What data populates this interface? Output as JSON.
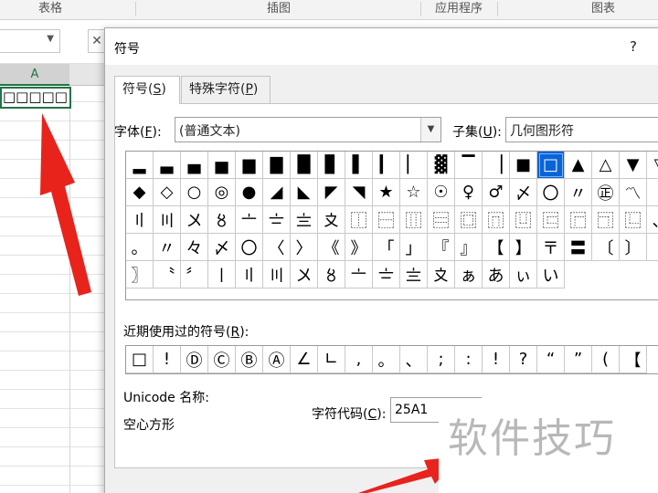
{
  "ribbon": {
    "groups": [
      "表格",
      "插图",
      "应用程序",
      "图表"
    ]
  },
  "sheet": {
    "column_a": "A",
    "cell_a1": "□□□□□"
  },
  "dialog": {
    "title": "符号",
    "help": "?",
    "tabs": [
      {
        "label": "符号(",
        "key": "S",
        "end": ")"
      },
      {
        "label": "特殊字符(",
        "key": "P",
        "end": ")"
      }
    ],
    "font": {
      "label_pre": "字体(",
      "label_key": "F",
      "label_post": "):",
      "value": "(普通文本)"
    },
    "subset": {
      "label_pre": "子集(",
      "label_key": "U",
      "label_post": "):",
      "value": "几何图形符"
    },
    "symbols": [
      "▂",
      "▃",
      "▄",
      "▅",
      "▆",
      "▇",
      "█",
      "▊",
      "▌",
      "▎",
      "▏",
      "▓",
      "▔",
      "▕",
      "■",
      "□",
      "▲",
      "△",
      "▼",
      "▽",
      "◆",
      "◇",
      "○",
      "◎",
      "●",
      "◢",
      "◣",
      "◤",
      "◥",
      "★",
      "☆",
      "☉",
      "♀",
      "♂",
      "〆",
      "〇",
      "〃",
      "㊣",
      "〽",
      "〡",
      "〢",
      "〣",
      "〤",
      "〥",
      "〦",
      "〧",
      "〨",
      "〩",
      "⿰",
      "⿱",
      "⿲",
      "⿳",
      "⿴",
      "⿵",
      "⿶",
      "⿷",
      "⿸",
      "⿹",
      "⿺",
      "、",
      "。",
      "〃",
      "々",
      "〆",
      "〇",
      "〈",
      "〉",
      "《",
      "》",
      "「",
      "」",
      "『",
      "』",
      "【",
      "】",
      "〒",
      "〓",
      "〔",
      "〕",
      "〖",
      "〗",
      "〝",
      "〞",
      "〡",
      "〢",
      "〣",
      "〤",
      "〥",
      "〦",
      "〧",
      "〨",
      "〩",
      "ぁ",
      "あ",
      "ぃ",
      "い"
    ],
    "selected_index": 15,
    "recent_label_pre": "近期使用过的符号(",
    "recent_label_key": "R",
    "recent_label_post": "):",
    "recent_symbols": [
      "□",
      "!",
      "Ⓓ",
      "Ⓒ",
      "Ⓑ",
      "Ⓐ",
      "∠",
      "∟",
      ",",
      "。",
      "、",
      ";",
      ":",
      "!",
      "?",
      "“",
      "”",
      "(",
      "【"
    ],
    "unicode_name_label": "Unicode 名称:",
    "unicode_name_value": "空心方形",
    "charcode_label_pre": "字符代码(",
    "charcode_label_key": "C",
    "charcode_label_post": "):",
    "charcode_value": "25A1"
  },
  "watermark": "软件技巧"
}
